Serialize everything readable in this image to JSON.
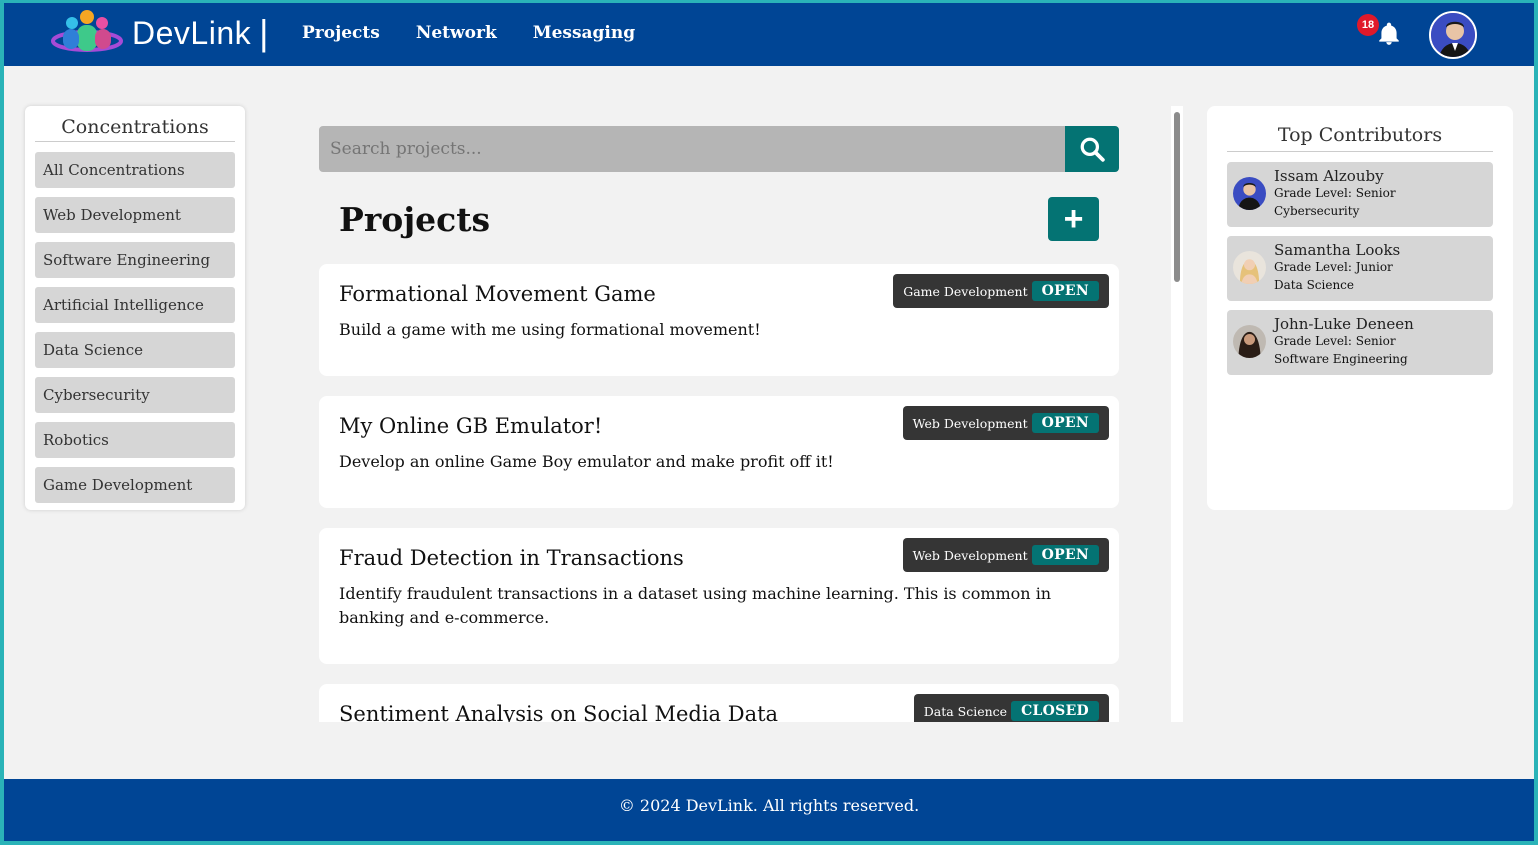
{
  "header": {
    "brand": "DevLink",
    "brand_separator": "|",
    "nav": [
      {
        "label": "Projects"
      },
      {
        "label": "Network"
      },
      {
        "label": "Messaging"
      }
    ],
    "notification_count": "18",
    "bell_icon": "bell-icon"
  },
  "left_panel": {
    "title": "Concentrations",
    "items": [
      {
        "label": "All Concentrations"
      },
      {
        "label": "Web Development"
      },
      {
        "label": "Software Engineering"
      },
      {
        "label": "Artificial Intelligence"
      },
      {
        "label": "Data Science"
      },
      {
        "label": "Cybersecurity"
      },
      {
        "label": "Robotics"
      },
      {
        "label": "Game Development"
      }
    ]
  },
  "search": {
    "placeholder": "Search projects..."
  },
  "projects": {
    "title": "Projects",
    "add_label": "+",
    "cards": [
      {
        "title": "Formational Movement Game",
        "description": "Build a game with me using formational movement!",
        "category": "Game Development",
        "status": "OPEN"
      },
      {
        "title": "My Online GB Emulator!",
        "description": "Develop an online Game Boy emulator and make profit off it!",
        "category": "Web Development",
        "status": "OPEN"
      },
      {
        "title": "Fraud Detection in Transactions",
        "description": "Identify fraudulent transactions in a dataset using machine learning. This is common in banking and e-commerce.",
        "category": "Web Development",
        "status": "OPEN"
      },
      {
        "title": "Sentiment Analysis on Social Media Data",
        "description": "",
        "category": "Data Science",
        "status": "CLOSED"
      }
    ]
  },
  "right_panel": {
    "title": "Top Contributors",
    "contributors": [
      {
        "name": "Issam Alzouby",
        "grade": "Grade Level: Senior",
        "concentration": "Cybersecurity"
      },
      {
        "name": "Samantha Looks",
        "grade": "Grade Level: Junior",
        "concentration": "Data Science"
      },
      {
        "name": "John-Luke Deneen",
        "grade": "Grade Level: Senior",
        "concentration": "Software Engineering"
      }
    ]
  },
  "footer": {
    "text": "© 2024 DevLink. All rights reserved."
  },
  "colors": {
    "primary": "#004595",
    "accent": "#047373",
    "badge": "#e0192a",
    "background": "#f2f2f2"
  }
}
